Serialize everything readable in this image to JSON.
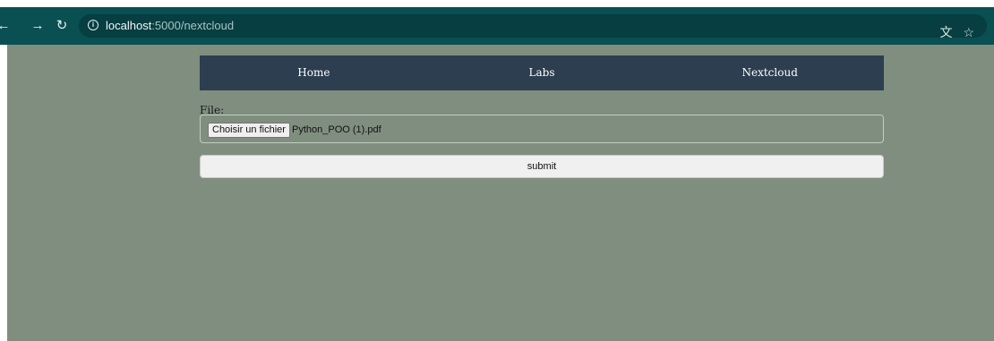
{
  "browser": {
    "back_icon": "back-arrow-icon",
    "forward_icon": "forward-arrow-icon",
    "reload_icon": "reload-icon",
    "site_info_icon": "info-icon",
    "url_host": "localhost",
    "url_rest": ":5000/nextcloud",
    "translate_icon": "translate-icon",
    "bookmark_icon": "star-icon"
  },
  "navbar": {
    "items": [
      {
        "label": "Home"
      },
      {
        "label": "Labs"
      },
      {
        "label": "Nextcloud"
      }
    ],
    "background": "#2c3e50"
  },
  "form": {
    "file_label": "File:",
    "choose_button_label": "Choisir un fichier",
    "selected_file_name": "Python_POO (1).pdf",
    "submit_label": "submit"
  },
  "colors": {
    "page_background": "#808e80",
    "toolbar_background": "#0a4f52"
  }
}
